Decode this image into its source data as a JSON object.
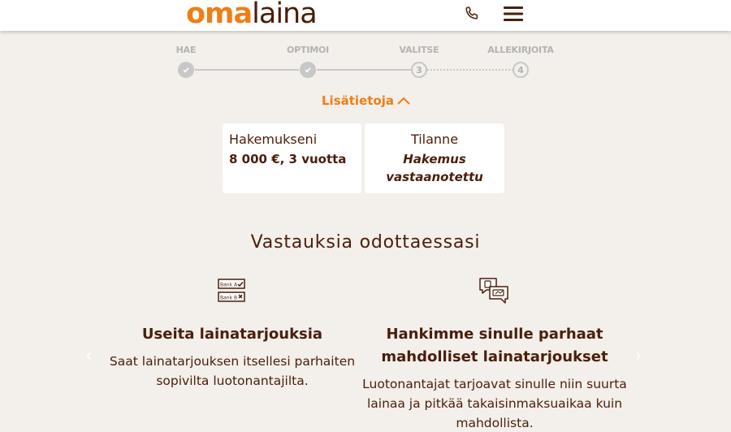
{
  "header": {
    "logo_part1": "oma",
    "logo_part2": "laina",
    "phone_icon": "phone-icon",
    "menu_icon": "hamburger-menu-icon"
  },
  "steps": [
    {
      "label": "HAE",
      "state": "done",
      "number": ""
    },
    {
      "label": "OPTIMOI",
      "state": "done",
      "number": ""
    },
    {
      "label": "VALITSE",
      "state": "todo",
      "number": "3"
    },
    {
      "label": "ALLEKIRJOITA",
      "state": "todo",
      "number": "4"
    }
  ],
  "more_info": {
    "label": "Lisätietoja",
    "icon": "chevron-up-icon"
  },
  "application_card": {
    "title": "Hakemukseni",
    "value": "8 000 €, 3 vuotta"
  },
  "status_card": {
    "title": "Tilanne",
    "value_line1": "Hakemus",
    "value_line2": "vastaanotettu"
  },
  "section_title": "Vastauksia odottaessasi",
  "slides": [
    {
      "icon": "bank-offers-icon",
      "icon_text_a": "Bank A",
      "icon_text_b": "Bank B",
      "heading": "Useita lainatarjouksia",
      "text_line1": "Saat lainatarjouksen itsellesi parhaiten",
      "text_line2": "sopivilta luotonantajilta."
    },
    {
      "icon": "chat-bubbles-icon",
      "heading_line1": "Hankimme sinulle parhaat",
      "heading_line2": "mahdolliset lainatarjoukset",
      "text_line1": "Luotonantajat tarjoavat sinulle niin suurta",
      "text_line2": "lainaa ja pitkää takaisinmaksuaikaa kuin",
      "text_line3": "mahdollista."
    }
  ],
  "carousel": {
    "prev_glyph": "‹",
    "next_glyph": "›"
  },
  "colors": {
    "brand_orange": "#f07d16",
    "brand_brown": "#4a1e0a",
    "background": "#f3efea",
    "step_gray": "#c8c8c8"
  }
}
